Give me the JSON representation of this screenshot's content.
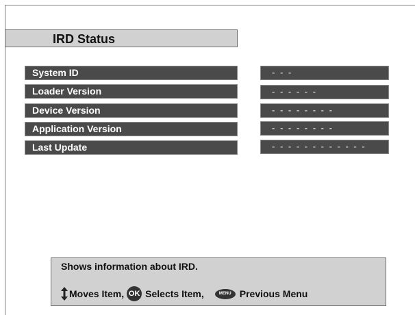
{
  "screen": {
    "title": "IRD Status"
  },
  "rows": [
    {
      "label": "System ID",
      "value": "- - -"
    },
    {
      "label": "Loader Version",
      "value": "- - - - - -"
    },
    {
      "label": "Device Version",
      "value": "- - - - - - - -"
    },
    {
      "label": "Application Version",
      "value": "- - - - - - - -"
    },
    {
      "label": "Last Update",
      "value": "- - - - - - - - - - - -"
    }
  ],
  "help": {
    "description": "Shows information about IRD.",
    "hints": {
      "moves_label": "Moves Item,",
      "ok_key_label": "OK",
      "selects_label": "Selects Item,",
      "menu_key_label": "MENU",
      "previous_label": "Previous Menu"
    }
  },
  "icons": {
    "updown": "up-down-arrow-icon",
    "ok": "ok-button-icon",
    "menu": "menu-button-icon"
  },
  "colors": {
    "title_bar_bg": "#d1d1d1",
    "row_bg": "#4a4a4a",
    "row_text": "#ffffff",
    "value_text": "#bfbfbf",
    "help_bg": "#d1d1d1"
  }
}
